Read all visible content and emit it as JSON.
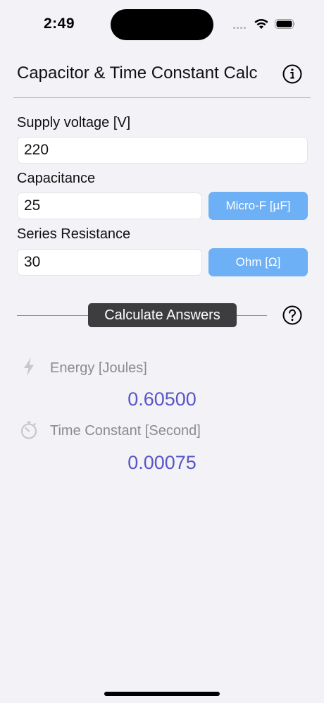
{
  "status_bar": {
    "time": "2:49"
  },
  "header": {
    "title": "Capacitor & Time Constant Calc"
  },
  "form": {
    "voltage": {
      "label": "Supply voltage [V]",
      "value": "220"
    },
    "capacitance": {
      "label": "Capacitance",
      "value": "25",
      "unit_label": "Micro-F [µF]"
    },
    "resistance": {
      "label": "Series Resistance",
      "value": "30",
      "unit_label": "Ohm [Ω]"
    }
  },
  "calculate": {
    "label": "Calculate Answers"
  },
  "results": {
    "energy": {
      "label": "Energy [Joules]",
      "value": "0.60500",
      "icon": "bolt-icon"
    },
    "time_constant": {
      "label": "Time Constant [Second]",
      "value": "0.00075",
      "icon": "stopwatch-icon"
    }
  },
  "colors": {
    "background": "#f2f2f7",
    "unit_button": "#6db0f6",
    "calculate_button": "#3d3d3f",
    "result_value": "#5856c7"
  }
}
